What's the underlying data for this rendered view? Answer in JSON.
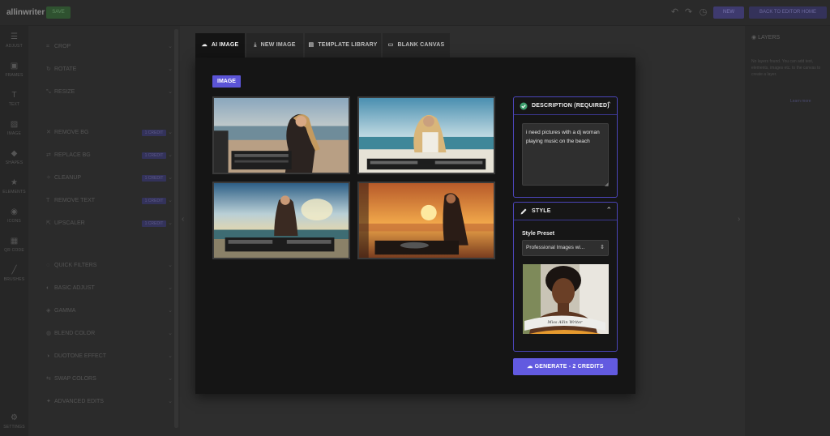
{
  "app": {
    "logo": "allinwriter",
    "save_label": "SAVE",
    "new_label": "NEW",
    "back_label": "BACK TO EDITOR HOME"
  },
  "left_rail": [
    {
      "icon": "sliders-icon",
      "label": "ADJUST"
    },
    {
      "icon": "frames-icon",
      "label": "FRAMES"
    },
    {
      "icon": "text-icon",
      "label": "TEXT"
    },
    {
      "icon": "image-icon",
      "label": "IMAGE"
    },
    {
      "icon": "shapes-icon",
      "label": "SHAPES"
    },
    {
      "icon": "star-icon",
      "label": "ELEMENTS"
    },
    {
      "icon": "globe-icon",
      "label": "ICONS"
    },
    {
      "icon": "qr-icon",
      "label": "QR CODE"
    },
    {
      "icon": "brush-icon",
      "label": "BRUSHES"
    },
    {
      "icon": "gear-icon",
      "label": "SETTINGS"
    }
  ],
  "tools": [
    {
      "label": "CROP",
      "badge": ""
    },
    {
      "label": "ROTATE",
      "badge": ""
    },
    {
      "label": "RESIZE",
      "badge": ""
    },
    {
      "label": "REMOVE BG",
      "badge": "1 CREDIT"
    },
    {
      "label": "REPLACE BG",
      "badge": "1 CREDIT"
    },
    {
      "label": "CLEANUP",
      "badge": "1 CREDIT"
    },
    {
      "label": "REMOVE TEXT",
      "badge": "1 CREDIT"
    },
    {
      "label": "UPSCALER",
      "badge": "1 CREDIT"
    },
    {
      "label": "QUICK FILTERS",
      "badge": ""
    },
    {
      "label": "BASIC ADJUST",
      "badge": ""
    },
    {
      "label": "GAMMA",
      "badge": ""
    },
    {
      "label": "BLEND COLOR",
      "badge": ""
    },
    {
      "label": "DUOTONE EFFECT",
      "badge": ""
    },
    {
      "label": "SWAP COLORS",
      "badge": ""
    },
    {
      "label": "ADVANCED EDITS",
      "badge": ""
    }
  ],
  "layers_panel": {
    "title": "LAYERS",
    "empty_text": "No layers found. You can add text, elements, images etc. to the canvas to create a layer.",
    "link": "Learn more"
  },
  "modal": {
    "tabs": [
      {
        "label": "AI IMAGE",
        "icon": "cloud-icon",
        "active": true
      },
      {
        "label": "NEW IMAGE",
        "icon": "upload-icon",
        "active": false
      },
      {
        "label": "TEMPLATE LIBRARY",
        "icon": "library-icon",
        "active": false
      },
      {
        "label": "BLANK CANVAS",
        "icon": "canvas-icon",
        "active": false
      }
    ],
    "image_badge": "IMAGE",
    "description": {
      "title": "DESCRIPTION (REQUIRED)",
      "value": "i need pictures with a dj woman playing music on the beach"
    },
    "style": {
      "title": "STYLE",
      "preset_label": "Style Preset",
      "preset_value": "Professional Images wi...",
      "preview_caption": "Miss Allin Writer"
    },
    "generate_label": "GENERATE - 2 CREDITS"
  },
  "colors": {
    "accent": "#625ae0",
    "badge": "#5b54d6",
    "card_border": "#4b45b8",
    "modal_bg": "#151515"
  }
}
